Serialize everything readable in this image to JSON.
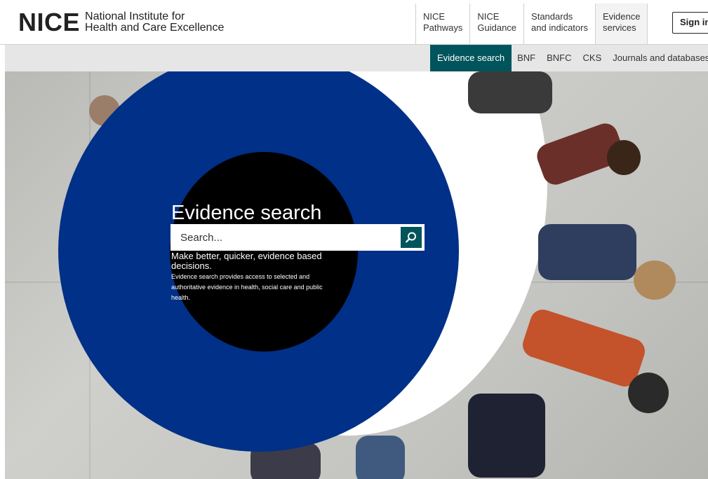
{
  "header": {
    "logo_mark": "NICE",
    "logo_line1": "National Institute for",
    "logo_line2": "Health and Care Excellence",
    "nav": [
      {
        "line1": "NICE",
        "line2": "Pathways"
      },
      {
        "line1": "NICE",
        "line2": "Guidance"
      },
      {
        "line1": "Standards",
        "line2": "and indicators"
      },
      {
        "line1": "Evidence",
        "line2": "services"
      }
    ],
    "signin_label": "Sign in"
  },
  "subnav": {
    "items": [
      "Evidence search",
      "BNF",
      "BNFC",
      "CKS",
      "Journals and databases"
    ]
  },
  "hero": {
    "title": "Evidence search",
    "search_placeholder": "Search...",
    "tagline": "Make better, quicker, evidence based decisions.",
    "description": "Evidence search provides access to selected and authoritative evidence in health, social care and public health."
  },
  "icons": {
    "search_button": "magnifier-icon"
  },
  "colors": {
    "brand_teal": "#00545b",
    "hero_blue": "#003087",
    "black": "#000000"
  }
}
